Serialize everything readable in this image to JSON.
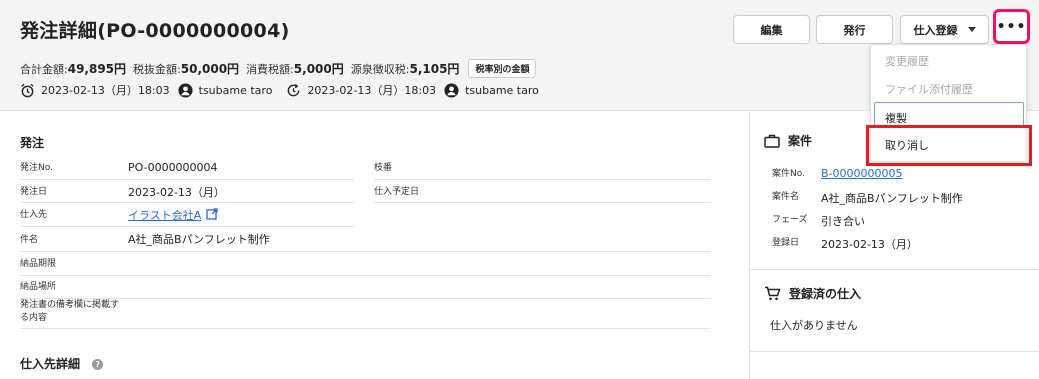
{
  "header": {
    "title": "発注詳細(PO-0000000004)",
    "amounts": [
      {
        "label": "合計金額:",
        "value": "49,895円"
      },
      {
        "label": "税抜金額:",
        "value": "50,000円"
      },
      {
        "label": "消費税額:",
        "value": "5,000円"
      },
      {
        "label": "源泉徴収税:",
        "value": "5,105円"
      }
    ],
    "tax_badge": "税率別の金額",
    "created_at": "2023-02-13（月）18:03",
    "created_by": "tsubame taro",
    "updated_at": "2023-02-13（月）18:03",
    "updated_by": "tsubame taro"
  },
  "toolbar": {
    "edit": "編集",
    "issue": "発行",
    "purchase_register": "仕入登録",
    "more": "•••"
  },
  "menu": {
    "items": [
      "変更履歴",
      "ファイル添付履歴",
      "複製",
      "取り消し"
    ]
  },
  "order": {
    "section_title": "発注",
    "po_no_label": "発注No.",
    "po_no": "PO-0000000004",
    "branch_label": "枝番",
    "order_date_label": "発注日",
    "order_date": "2023-02-13（月）",
    "planned_date_label": "仕入予定日",
    "supplier_label": "仕入先",
    "supplier": "イラスト会社A",
    "subject_label": "件名",
    "subject": "A社_商品Bパンフレット制作",
    "deadline_label": "納品期限",
    "place_label": "納品場所",
    "remarks_label": "発注書の備考欄に掲載する内容",
    "supplier_detail_title": "仕入先詳細"
  },
  "project": {
    "title": "案件",
    "no_label": "案件No.",
    "no": "B-0000000005",
    "name_label": "案件名",
    "name": "A社_商品Bパンフレット制作",
    "phase_label": "フェーズ",
    "phase": "引き合い",
    "date_label": "登録日",
    "date": "2023-02-13（月）"
  },
  "purchases": {
    "title": "登録済の仕入",
    "empty": "仕入がありません"
  },
  "colors": {
    "highlight_pink": "#ee1166",
    "highlight_red": "#e21e1e",
    "link": "#2b6cd0"
  }
}
